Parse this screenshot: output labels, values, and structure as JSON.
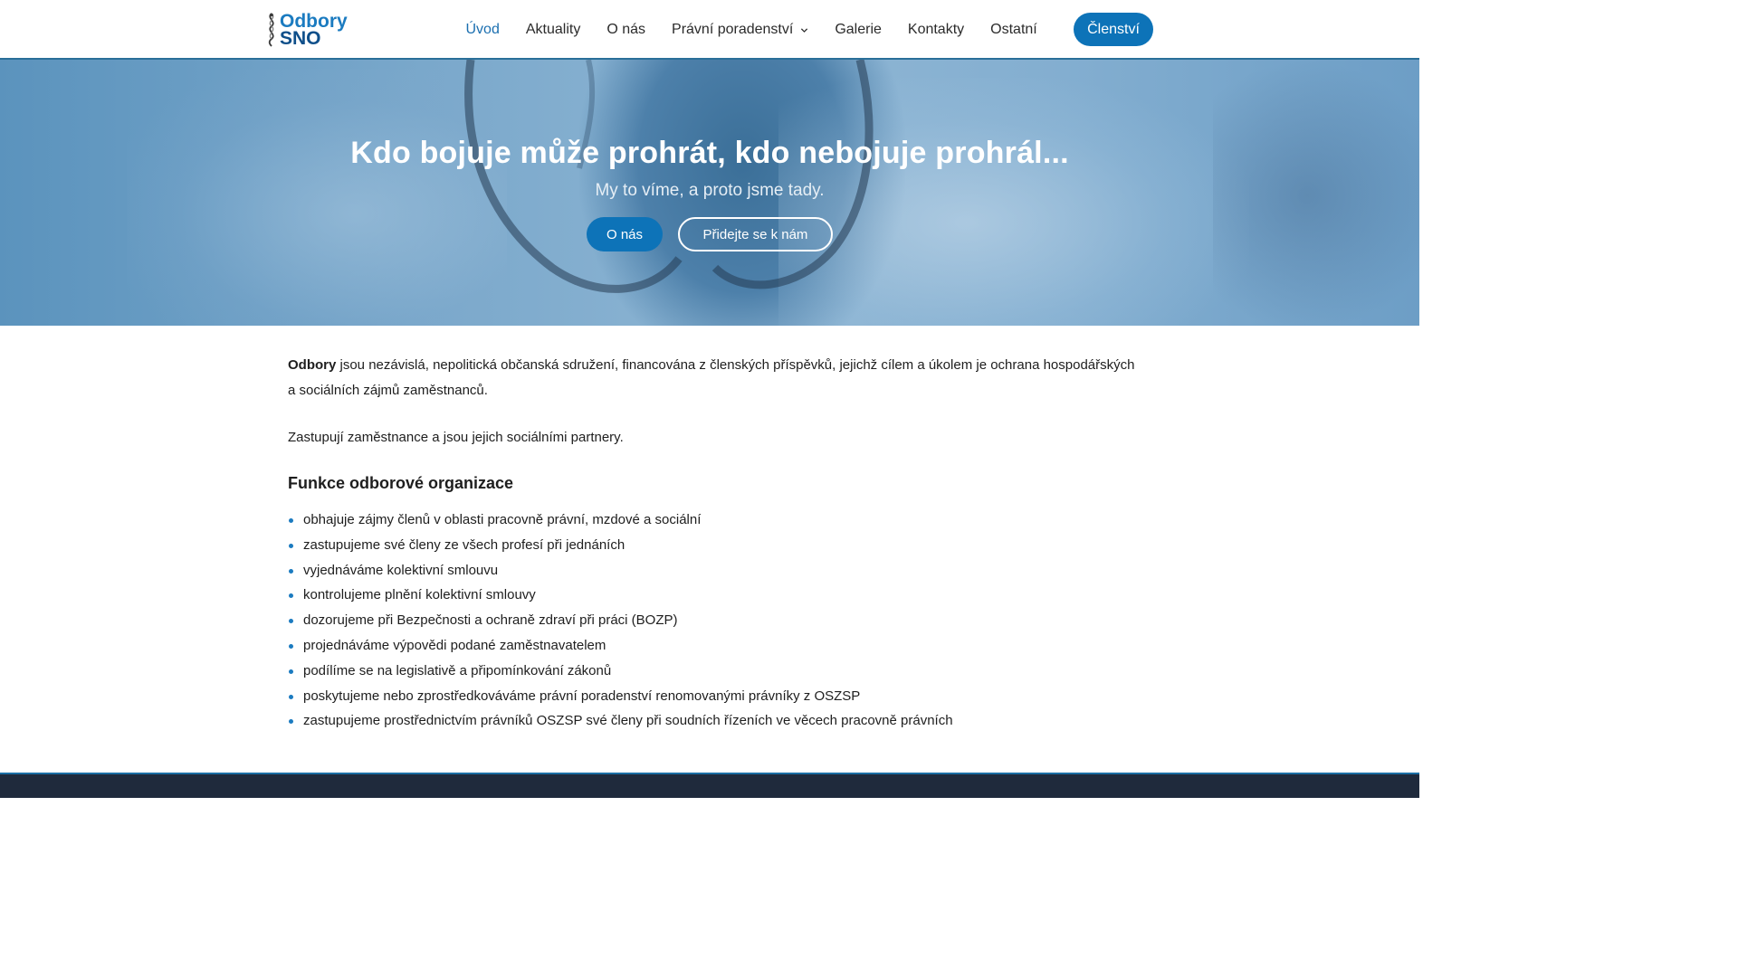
{
  "header": {
    "logo": {
      "line1": "Odbory",
      "line2": "SNO"
    },
    "nav": [
      {
        "label": "Úvod",
        "active": true
      },
      {
        "label": "Aktuality"
      },
      {
        "label": "O nás"
      },
      {
        "label": "Právní poradenství",
        "has_dropdown": true
      },
      {
        "label": "Galerie"
      },
      {
        "label": "Kontakty"
      },
      {
        "label": "Ostatní"
      }
    ],
    "cta_label": "Členství"
  },
  "hero": {
    "title": "Kdo bojuje může prohrát, kdo nebojuje prohrál...",
    "subtitle": "My to víme, a proto jsme tady.",
    "button_primary": "O nás",
    "button_secondary": "Přidejte se k nám"
  },
  "main": {
    "intro_bold": "Odbory",
    "intro_rest": " jsou nezávislá, nepolitická občanská sdružení, financována z členských příspěvků, jejichž cílem a úkolem je ochrana hospodářských a sociálních zájmů zaměstnanců.",
    "intro2": "Zastupují zaměstnance a jsou jejich sociálními partnery.",
    "functions_heading": "Funkce odborové organizace",
    "functions": [
      "obhajuje zájmy členů v oblasti pracovně právní, mzdové a sociální",
      "zastupujeme své členy ze všech profesí při jednáních",
      "vyjednáváme kolektivní smlouvu",
      "kontrolujeme plnění kolektivní smlouvy",
      "dozorujeme při Bezpečnosti a ochraně zdraví při práci (BOZP)",
      "projednáváme výpovědi podané zaměstnavatelem",
      "podílíme se na legislativě a připomínkování zákonů",
      "poskytujeme nebo zprostředkováváme právní poradenství renomovanými právníky z OSZSP",
      "zastupujeme prostřednictvím právníků OSZSP své členy při soudních řízeních ve věcech pracovně právních"
    ]
  },
  "colors": {
    "accent": "#0d73b8",
    "footer": "#1f2a3c",
    "header_border": "#2a6f99"
  },
  "icons": {
    "logo": "caduceus-icon",
    "dropdown": "chevron-down-icon",
    "bullet": "bullet-icon"
  }
}
